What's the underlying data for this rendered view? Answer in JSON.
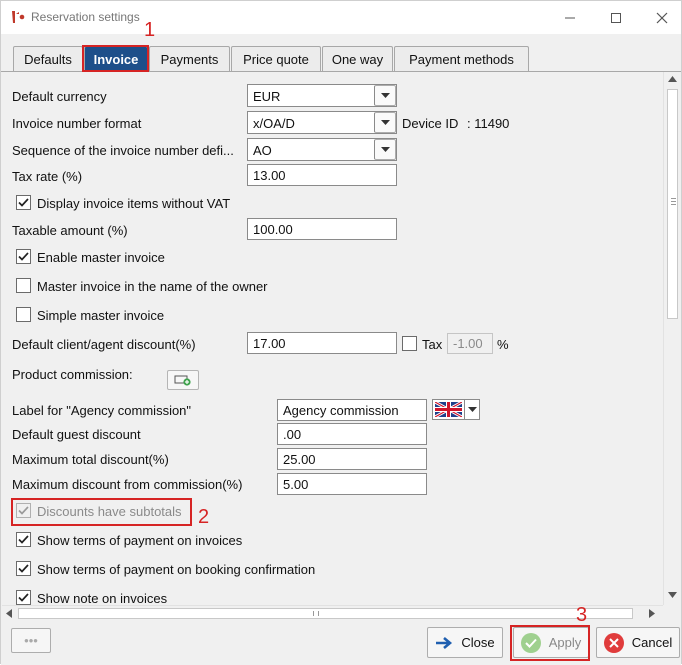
{
  "window": {
    "title": "Reservation settings"
  },
  "tabs": [
    {
      "label": "Defaults"
    },
    {
      "label": "Invoice"
    },
    {
      "label": "Payments"
    },
    {
      "label": "Price quote"
    },
    {
      "label": "One way"
    },
    {
      "label": "Payment methods"
    }
  ],
  "active_tab": "Invoice",
  "callouts": {
    "one": "1",
    "two": "2",
    "three": "3"
  },
  "form": {
    "default_currency": {
      "label": "Default currency",
      "value": "EUR"
    },
    "invoice_number_format": {
      "label": "Invoice number format",
      "value": "x/OA/D"
    },
    "device_id": {
      "label": "Device ID",
      "value": ": 11490"
    },
    "sequence": {
      "label": "Sequence of the invoice number defi...",
      "value": "AO"
    },
    "tax_rate": {
      "label": "Tax rate  (%)",
      "value": "13.00"
    },
    "display_without_vat": {
      "label": "Display invoice items without VAT",
      "checked": true
    },
    "taxable_amount": {
      "label": "Taxable amount (%)",
      "value": "100.00"
    },
    "enable_master_invoice": {
      "label": "Enable master invoice",
      "checked": true
    },
    "master_invoice_owner": {
      "label": "Master invoice in the name of the owner",
      "checked": false
    },
    "simple_master_invoice": {
      "label": "Simple master invoice",
      "checked": false
    },
    "client_agent_discount": {
      "label": "Default client/agent discount(%)",
      "value": "17.00"
    },
    "tax": {
      "label": "Tax",
      "value": "-1.00",
      "unit": "%",
      "checked": false
    },
    "product_commission": {
      "label": "Product commission:"
    },
    "agency_commission_label": {
      "label": "Label for \"Agency commission\"",
      "value": "Agency commission"
    },
    "default_guest_discount": {
      "label": "Default guest discount",
      "value": ".00"
    },
    "max_total_discount": {
      "label": "Maximum total discount(%)",
      "value": "25.00"
    },
    "max_discount_commission": {
      "label": "Maximum discount from commission(%)",
      "value": "5.00"
    },
    "discounts_subtotals": {
      "label": "Discounts have subtotals",
      "checked": true,
      "disabled": true
    },
    "terms_on_invoices": {
      "label": "Show terms of payment on invoices",
      "checked": true
    },
    "terms_on_booking": {
      "label": "Show terms of payment on booking confirmation",
      "checked": true
    },
    "note_on_invoices": {
      "label": "Show note on invoices",
      "checked": true
    }
  },
  "footer": {
    "more_label": "•••",
    "close_label": "Close",
    "apply_label": "Apply",
    "cancel_label": "Cancel"
  },
  "colors": {
    "active_tab": "#1d4f8a",
    "annotation": "#d62424",
    "apply_icon": "#6fbf5a",
    "cancel_icon": "#e03c3c",
    "close_icon": "#1f5fb0"
  }
}
